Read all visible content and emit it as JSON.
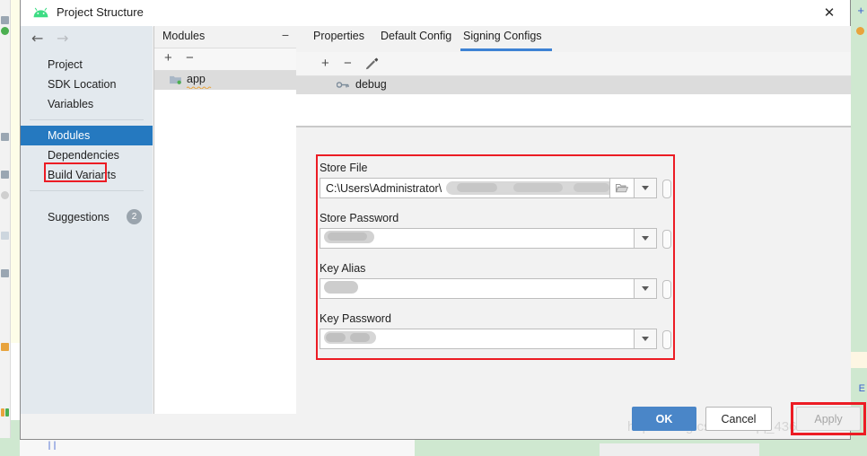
{
  "window": {
    "title": "Project Structure",
    "app_icon": "android-logo-icon",
    "close_label": "✕"
  },
  "nav": {
    "back_icon": "←",
    "forward_icon": "→",
    "items": [
      {
        "label": "Project",
        "selected": false
      },
      {
        "label": "SDK Location",
        "selected": false
      },
      {
        "label": "Variables",
        "selected": false
      },
      {
        "label": "Modules",
        "selected": true
      },
      {
        "label": "Dependencies",
        "selected": false
      },
      {
        "label": "Build Variants",
        "selected": false
      }
    ],
    "suggestions": {
      "label": "Suggestions",
      "badge": "2"
    },
    "highlight_color": "#ec1c24",
    "selected_color": "#2579c0"
  },
  "modules_panel": {
    "title": "Modules",
    "collapse_icon": "−",
    "toolbar": {
      "add": "+",
      "remove": "−"
    },
    "items": [
      {
        "label": "app",
        "icon": "module-folder-icon",
        "selected": true
      }
    ]
  },
  "content": {
    "tabs": [
      {
        "label": "Properties",
        "active": false
      },
      {
        "label": "Default Config",
        "active": false
      },
      {
        "label": "Signing Configs",
        "active": true
      }
    ],
    "tab_underline_color": "#3d82d4",
    "config_toolbar": {
      "add": "+",
      "remove": "−",
      "edit": "pencil-icon"
    },
    "config_list": [
      {
        "label": "debug",
        "icon": "key-icon",
        "selected": true
      }
    ],
    "fields": [
      {
        "label": "Store File",
        "value": "C:\\Users\\Administrator\\",
        "redacted": true,
        "has_folder_button": true,
        "has_dropdown": true,
        "has_variable_button": true
      },
      {
        "label": "Store Password",
        "value": "",
        "redacted": true,
        "has_folder_button": false,
        "has_dropdown": true,
        "has_variable_button": true
      },
      {
        "label": "Key Alias",
        "value": "",
        "redacted": true,
        "has_folder_button": false,
        "has_dropdown": true,
        "has_variable_button": true
      },
      {
        "label": "Key Password",
        "value": "",
        "redacted": true,
        "has_folder_button": false,
        "has_dropdown": true,
        "has_variable_button": true
      }
    ]
  },
  "buttons": {
    "ok": "OK",
    "cancel": "Cancel",
    "apply": "Apply",
    "apply_enabled": false,
    "ok_color": "#4a86c8",
    "apply_highlight_color": "#ec1c24"
  },
  "watermark": "https://blog.csdn.net/qq_43688027"
}
